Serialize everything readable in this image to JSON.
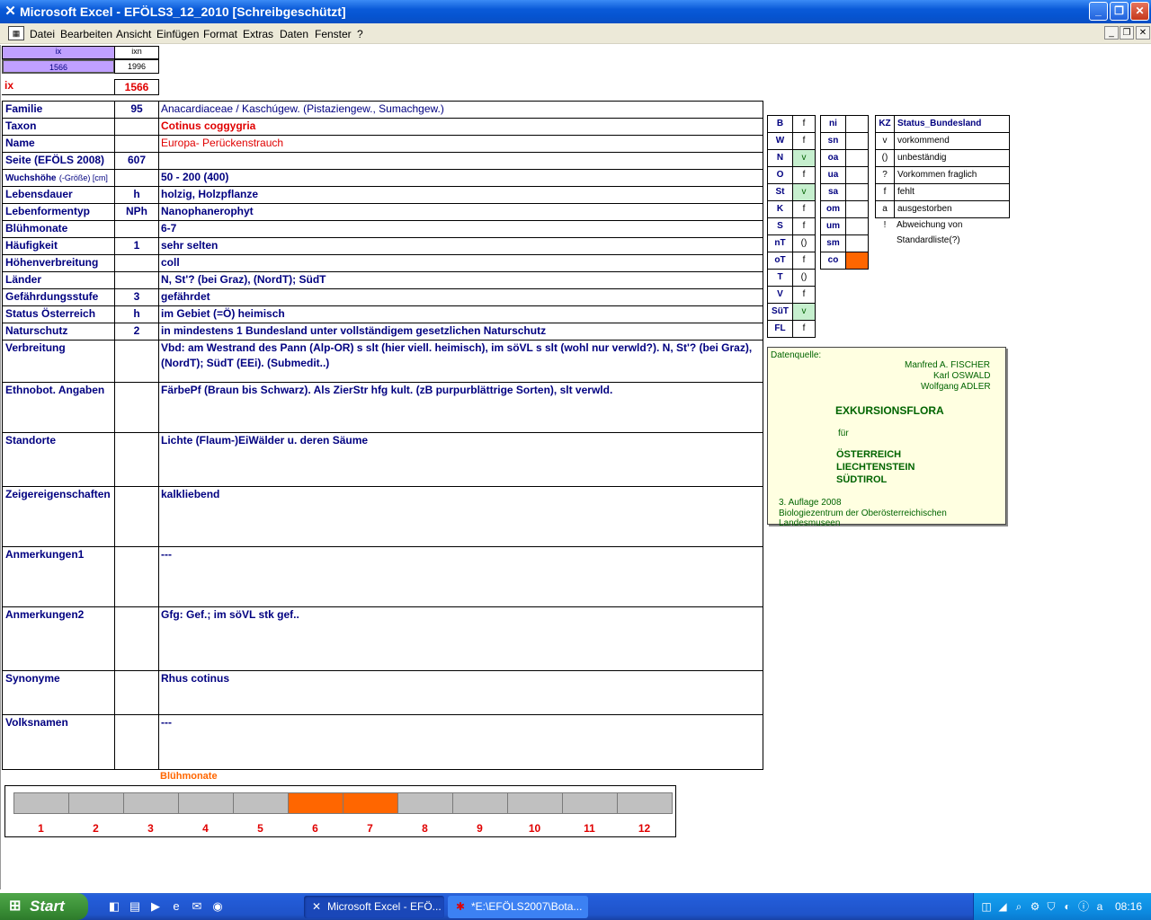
{
  "window": {
    "title": "Microsoft Excel - EFÖLS3_12_2010  [Schreibgeschützt]",
    "controls": {
      "minimize": "_",
      "maximize": "❐",
      "close": "✕"
    }
  },
  "menu": [
    "Datei",
    "Bearbeiten",
    "Ansicht",
    "Einfügen",
    "Format",
    "Extras",
    "Daten",
    "Fenster",
    "?"
  ],
  "mdi_controls": {
    "minimize": "_",
    "restore": "❐",
    "close": "✕"
  },
  "top": {
    "col_ix": "ix",
    "col_ixn": "ixn",
    "val_ix": "1566",
    "val_ixn": "1996",
    "ix_label": "ix",
    "ix_value": "1566"
  },
  "rows": [
    {
      "label": "Familie",
      "num": "95",
      "value": "Anacardiaceae  /  Kaschúgew. (Pistaziengew., Sumachgew.)"
    },
    {
      "label": "Taxon",
      "num": "",
      "value": "Cotinus coggygria"
    },
    {
      "label": "Name",
      "num": "",
      "value": "Europa- Perückenstrauch"
    },
    {
      "label": "Seite (EFÖLS 2008)",
      "num": "607",
      "value": ""
    },
    {
      "label": "Wuchshöhe",
      "label_note": "(-Größe) [cm]",
      "num": "",
      "value": "50 - 200 (400)"
    },
    {
      "label": "Lebensdauer",
      "num": "h",
      "value": "holzig, Holzpflanze"
    },
    {
      "label": "Lebenformentyp",
      "num": "NPh",
      "value": "Nanophanerophyt"
    },
    {
      "label": "Blühmonate",
      "num": "",
      "value": "6-7"
    },
    {
      "label": "Häufigkeit",
      "num": "1",
      "value": "sehr selten"
    },
    {
      "label": "Höhenverbreitung",
      "num": "",
      "value": "coll"
    },
    {
      "label": "Länder",
      "num": "",
      "value": "N, St'? (bei Graz), (NordT); SüdT"
    },
    {
      "label": "Gefährdungsstufe",
      "num": "3",
      "value": "gefährdet"
    },
    {
      "label": "Status Österreich",
      "num": "h",
      "value": "im Gebiet (=Ö) heimisch"
    },
    {
      "label": "Naturschutz",
      "num": "2",
      "value": "in mindestens 1 Bundesland unter vollständigem gesetzlichen Naturschutz"
    },
    {
      "label": "Verbreitung",
      "num": "",
      "value": "Vbd: am Westrand des Pann (Alp-OR) s slt (hier viell. heimisch), im söVL s slt (wohl nur verwld?). N, St'? (bei Graz), (NordT); SüdT (EEi). (Submedit..)"
    },
    {
      "label": "Ethnobot. Angaben",
      "num": "",
      "value": "FärbePf (Braun bis Schwarz). Als ZierStr hfg kult. (zB purpurblättrige Sorten), slt verwld."
    },
    {
      "label": "Standorte",
      "num": "",
      "value": "Lichte (Flaum-)EiWälder u. deren Säume"
    },
    {
      "label": "Zeigereigenschaften",
      "num": "",
      "value": " kalkliebend"
    },
    {
      "label": "Anmerkungen1",
      "num": "",
      "value": "---"
    },
    {
      "label": "Anmerkungen2",
      "num": "",
      "value": "Gfg: Gef.; im söVL stk gef.."
    },
    {
      "label": "Synonyme",
      "num": "",
      "value": "Rhus cotinus"
    },
    {
      "label": "Volksnamen",
      "num": "",
      "value": "---"
    }
  ],
  "status_left": [
    {
      "k": "B",
      "v": "f"
    },
    {
      "k": "W",
      "v": "f"
    },
    {
      "k": "N",
      "v": "v"
    },
    {
      "k": "O",
      "v": "f"
    },
    {
      "k": "St",
      "v": "v"
    },
    {
      "k": "K",
      "v": "f"
    },
    {
      "k": "S",
      "v": "f"
    },
    {
      "k": "nT",
      "v": "()"
    },
    {
      "k": "oT",
      "v": "f"
    },
    {
      "k": "T",
      "v": "()"
    },
    {
      "k": "V",
      "v": "f"
    },
    {
      "k": "SüT",
      "v": "v"
    },
    {
      "k": "FL",
      "v": "f"
    }
  ],
  "status_right": [
    {
      "k": "ni",
      "v": ""
    },
    {
      "k": "sn",
      "v": ""
    },
    {
      "k": "oa",
      "v": ""
    },
    {
      "k": "ua",
      "v": ""
    },
    {
      "k": "sa",
      "v": ""
    },
    {
      "k": "om",
      "v": ""
    },
    {
      "k": "um",
      "v": ""
    },
    {
      "k": "sm",
      "v": ""
    },
    {
      "k": "co",
      "v": ""
    }
  ],
  "legend": {
    "header_kz": "KZ",
    "header_status": "Status_Bundesland",
    "items": [
      {
        "kz": "v",
        "text": "vorkommend"
      },
      {
        "kz": "()",
        "text": "unbeständig"
      },
      {
        "kz": "?",
        "text": "Vorkommen fraglich"
      },
      {
        "kz": "f",
        "text": "fehlt"
      },
      {
        "kz": "a",
        "text": "ausgestorben"
      },
      {
        "kz": "!",
        "text": "Abweichung von Standardliste(?)"
      }
    ]
  },
  "source": {
    "label": "Datenquelle:",
    "author1": "Manfred A. FISCHER",
    "author2": "Karl OSWALD",
    "author3": "Wolfgang ADLER",
    "book": "EXKURSIONSFLORA",
    "fuer": "für",
    "land1": "ÖSTERREICH",
    "land2": "LIECHTENSTEIN",
    "land3": "SÜDTIROL",
    "edition": "3. Auflage 2008",
    "publisher": "Biologiezentrum der Oberösterreichischen Landesmuseen"
  },
  "chart_data": {
    "type": "bar",
    "title": "Blühmonate",
    "categories": [
      "1",
      "2",
      "3",
      "4",
      "5",
      "6",
      "7",
      "8",
      "9",
      "10",
      "11",
      "12"
    ],
    "values": [
      0,
      0,
      0,
      0,
      0,
      1,
      1,
      0,
      0,
      0,
      0,
      0
    ],
    "colors": {
      "active": "#ff6600",
      "inactive": "#c0c0c0"
    }
  },
  "taskbar": {
    "start": "Start",
    "tasks": [
      {
        "label": "Microsoft Excel - EFÖ...",
        "icon": "excel-icon"
      },
      {
        "label": "*E:\\EFÖLS2007\\Bota...",
        "icon": "app-icon"
      }
    ],
    "clock": "08:16"
  },
  "colors": {
    "label": "#000080",
    "accent_red": "#e00000",
    "orange": "#ff6600",
    "purple": "#c0a0ff",
    "green": "#c6efce"
  }
}
